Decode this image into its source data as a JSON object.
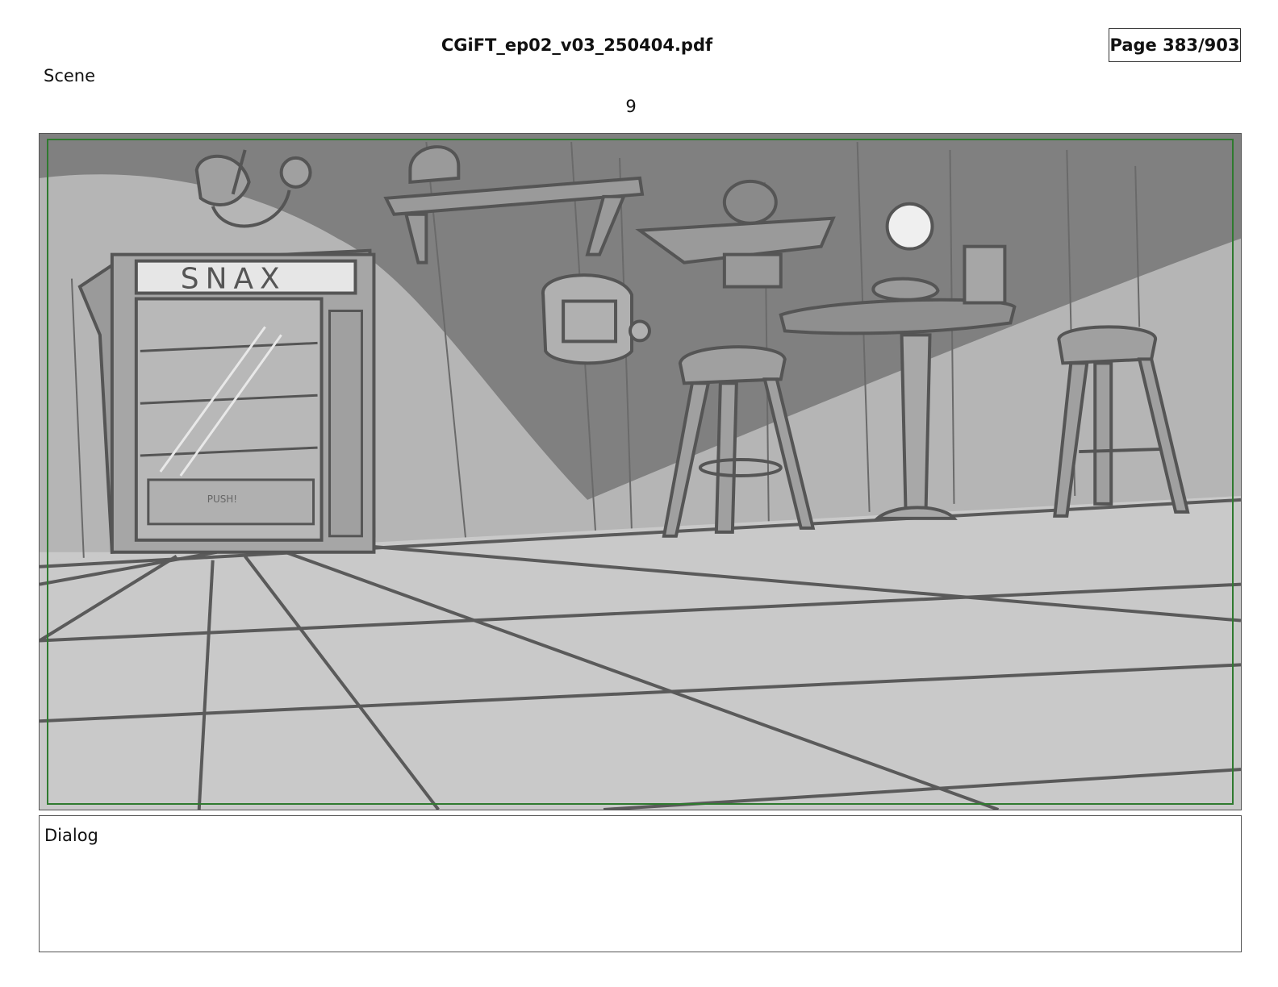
{
  "header": {
    "file_title": "CGiFT_ep02_v03_250404.pdf",
    "page_indicator": "Page 383/903"
  },
  "scene": {
    "label": "Scene",
    "panel_number": "9"
  },
  "sketch": {
    "vending_sign": "SNAX",
    "vending_push_label": "PUSH!"
  },
  "dialog": {
    "label": "Dialog"
  },
  "colors": {
    "safe_area": "#2f7a2f",
    "wall_dark": "#808080",
    "wall_light": "#b5b5b5",
    "floor": "#c9c9c9",
    "ink": "#5a5a5a"
  }
}
